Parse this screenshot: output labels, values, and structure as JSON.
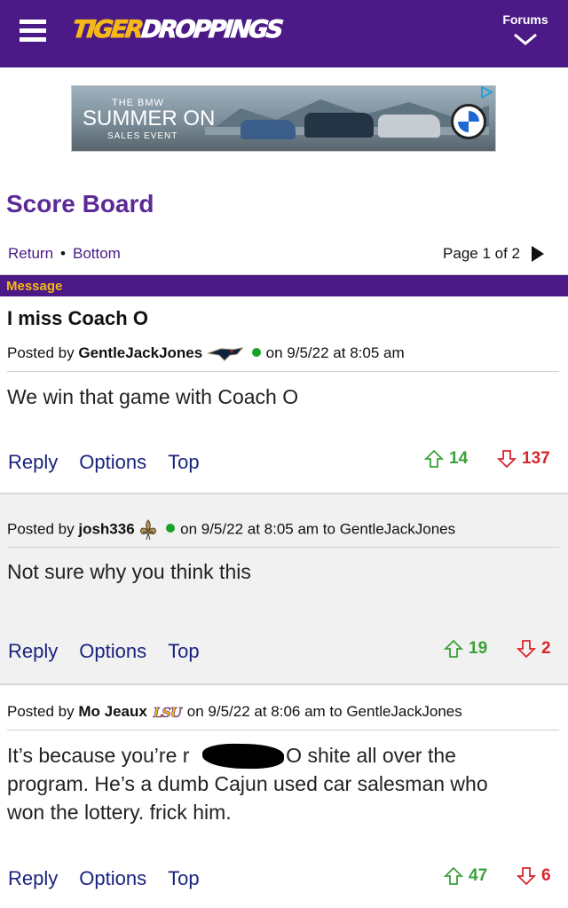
{
  "header": {
    "logo_part1": "TIGER",
    "logo_part2": "DROPPINGS",
    "forums_label": "Forums"
  },
  "ad": {
    "line1": "THE BMW",
    "line2": "SUMMER ON",
    "line3": "SALES EVENT",
    "brand_icon": "bmw-logo"
  },
  "board": {
    "title": "Score Board",
    "nav_return": "Return",
    "nav_bottom": "Bottom",
    "page_text": "Page 1 of 2"
  },
  "message_bar": "Message",
  "thread_title": "I miss Coach O",
  "posts": [
    {
      "posted_by_prefix": "Posted by",
      "author": "GentleJackJones",
      "badge_icon": "pelicans-logo",
      "date_text": "on 9/5/22 at 8:05 am",
      "reply_to": "",
      "body": "We win that game with Coach O",
      "reply_label": "Reply",
      "options_label": "Options",
      "top_label": "Top",
      "upvotes": "14",
      "downvotes": "137"
    },
    {
      "posted_by_prefix": "Posted by",
      "author": "josh336",
      "badge_icon": "fleur-de-lis-icon",
      "date_text": "on 9/5/22 at 8:05 am to GentleJackJones",
      "body": "Not sure why you think this",
      "reply_label": "Reply",
      "options_label": "Options",
      "top_label": "Top",
      "upvotes": "19",
      "downvotes": "2"
    },
    {
      "posted_by_prefix": "Posted by",
      "author": "Mo Jeaux",
      "badge_icon": "lsu-logo",
      "badge_text": "LSU",
      "date_text": "on 9/5/22 at 8:06 am to GentleJackJones",
      "body_line1a": "It’s because you’re r",
      "body_line1b": ". O shite all over the",
      "body_line2": "program. He’s a dumb Cajun used car salesman who",
      "body_line3": "won the lottery. frick him.",
      "reply_label": "Reply",
      "options_label": "Options",
      "top_label": "Top",
      "upvotes": "47",
      "downvotes": "6"
    }
  ],
  "colors": {
    "brand_purple": "#4b1a86",
    "brand_gold": "#f5b818",
    "upvote_green": "#3aa13a",
    "downvote_red": "#d8262d",
    "link_navy": "#1a237e"
  }
}
